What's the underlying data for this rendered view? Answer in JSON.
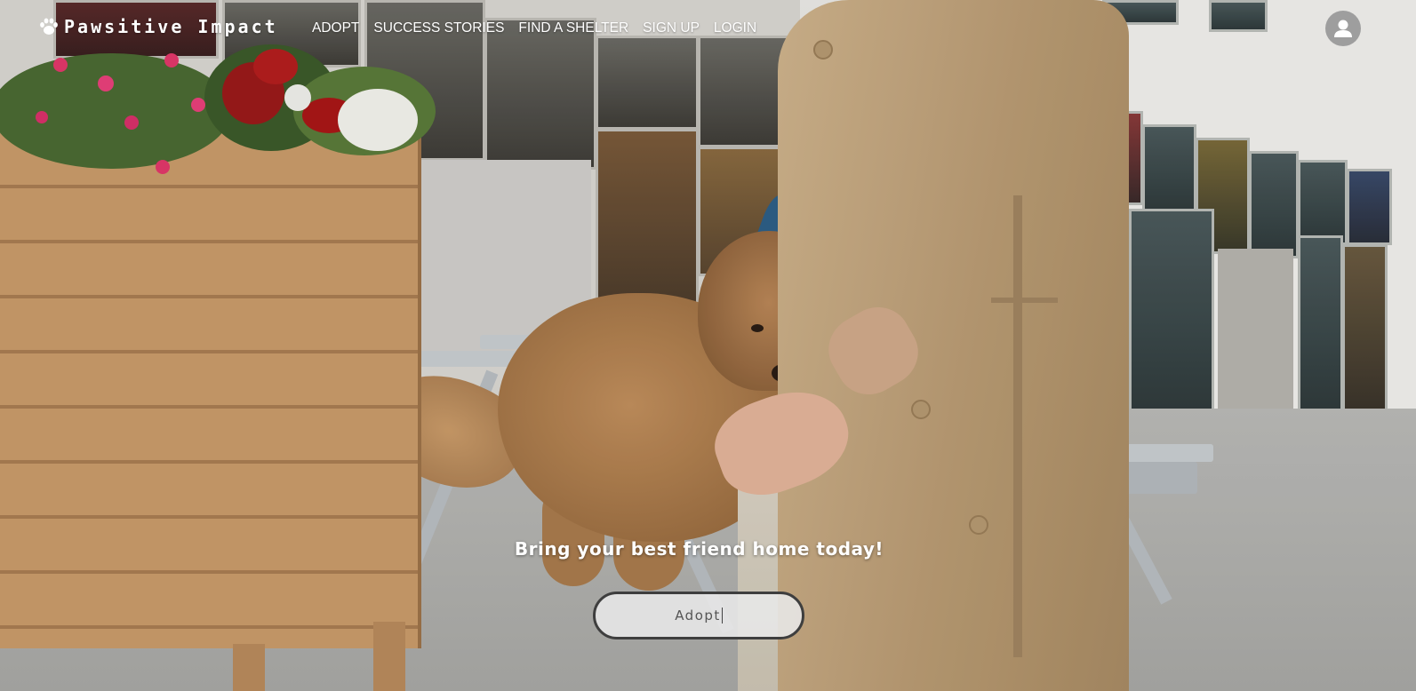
{
  "brand": {
    "name": "Pawsitive Impact",
    "icon": "paw-icon"
  },
  "nav": {
    "links": [
      {
        "label": "ADOPT"
      },
      {
        "label": "SUCCESS STORIES"
      },
      {
        "label": "FIND A SHELTER"
      },
      {
        "label": "SIGN UP"
      },
      {
        "label": "LOGIN"
      }
    ]
  },
  "account": {
    "icon": "user-avatar-icon"
  },
  "hero": {
    "tagline": "Bring your best friend home today!",
    "cta_label": "Adopt"
  },
  "colors": {
    "nav_text": "#ffffff",
    "avatar_bg": "#9e9e9e",
    "cta_border": "#3e3e3e",
    "cta_bg": "#e8e8e8"
  }
}
